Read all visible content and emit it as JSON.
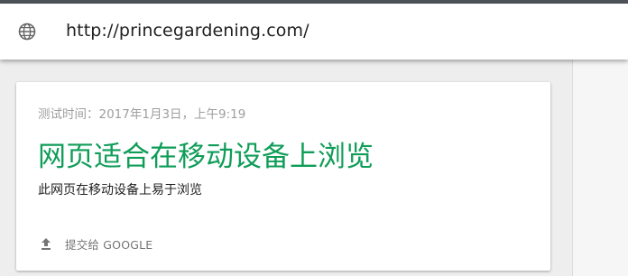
{
  "address_bar": {
    "url": "http://princegardening.com/",
    "icon": "globe-icon"
  },
  "result_card": {
    "test_time": "测试时间：2017年1月3日，上午9:19",
    "verdict_title": "网页适合在移动设备上浏览",
    "verdict_description": "此网页在移动设备上易于浏览",
    "submit_label": "提交给 GOOGLE",
    "submit_icon": "upload-icon"
  },
  "colors": {
    "verdict_green": "#0f9d58",
    "top_strip": "#4d5359",
    "muted_text": "#9e9e9e"
  }
}
